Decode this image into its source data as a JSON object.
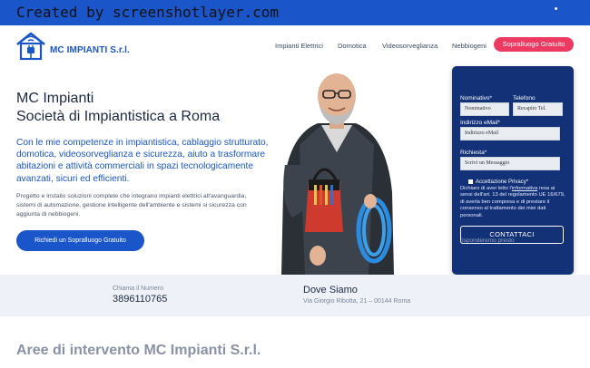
{
  "watermark": "Created by screenshotlayer.com",
  "topbar": {
    "text": ""
  },
  "brand": {
    "name": "MC IMPIANTI S.r.l."
  },
  "nav": {
    "items": [
      "Impianti Elettrici",
      "Domotica",
      "Videosorveglianza",
      "Nebbiogeni"
    ],
    "cta": "Sopralluogo Gratuito"
  },
  "hero": {
    "title_line1": "MC Impianti",
    "title_line2": "Società di Impiantistica a Roma",
    "lead": "Con le mie competenze in impiantistica, cablaggio strutturato, domotica, videosorveglianza e sicurezza, aiuto a trasformare abitazioni e attività commerciali in spazi tecnologicamente avanzati, sicuri ed efficienti.",
    "body": "Progetto e installo soluzioni complete che integrano impianti elettrici all'avanguardia, sistemi di automazione, gestione intelligente dell'ambiente e sistemi si sicurezza con aggiunta di nebbiogeni.",
    "button": "Richiedi un Sopralluogo Gratuito"
  },
  "form": {
    "name_label": "Nominativo*",
    "name_placeholder": "Nominativo",
    "phone_label": "Telefono",
    "phone_placeholder": "Recapito Tel.",
    "email_label": "Indirizzo eMail*",
    "email_placeholder": "Indirizzo eMail",
    "request_label": "Richiesta*",
    "request_placeholder": "Scrivi un Messaggio",
    "privacy_title": "Accettazione Privacy*",
    "privacy_pre": "Dichiaro di aver letto l'",
    "privacy_link": "informativa",
    "privacy_post": " resa ai sensi dell'art. 13 del regolamento UE 16/679, di averla ben compresa e di prestare il consenso al trattamento dei miei dati personali.",
    "submit": "CONTATTACI",
    "note": "risponderemo presto"
  },
  "info": {
    "call_label": "Chiama il Numero",
    "call_number": "3896110765",
    "where_title": "Dove Siamo",
    "where_address": "Via Giorgio Ribotta, 21 – 00144 Roma"
  },
  "areas": {
    "title": "Aree di intervento MC Impianti S.r.l."
  },
  "colors": {
    "primary": "#1a56c9",
    "accent": "#ee3a63",
    "form_bg": "#123177"
  }
}
